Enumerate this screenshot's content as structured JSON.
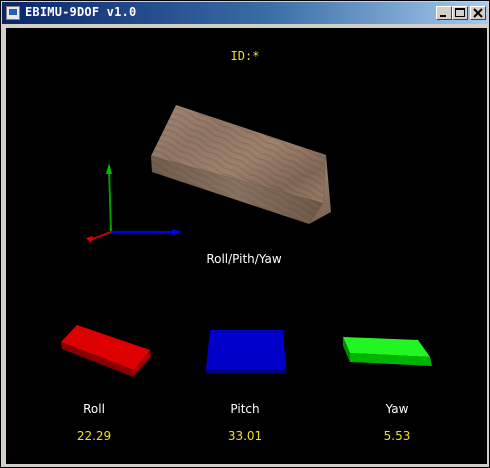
{
  "window": {
    "title": "EBIMU-9DOF v1.0",
    "controls": [
      "minimize",
      "maximize",
      "close"
    ]
  },
  "scene": {
    "id_label": "ID:*",
    "orientation_label": "Roll/Pith/Yaw",
    "axes_colors": {
      "x": "#0000ff",
      "y": "#00a000",
      "z": "#e00000"
    },
    "cube_texture": "wood",
    "indicators": {
      "roll": {
        "name": "Roll",
        "value": "22.29",
        "color": "#e00000"
      },
      "pitch": {
        "name": "Pitch",
        "value": "33.01",
        "color": "#0000e0"
      },
      "yaw": {
        "name": "Yaw",
        "value": "5.53",
        "color": "#00ff00"
      }
    }
  }
}
